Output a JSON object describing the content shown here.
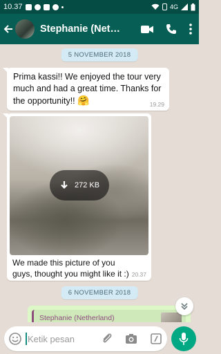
{
  "status_bar": {
    "time": "10.37",
    "network": "4G"
  },
  "header": {
    "contact_name": "Stephanie (Netherland)"
  },
  "messages": [
    {
      "type": "date",
      "text": "5 NOVEMBER 2018"
    },
    {
      "type": "text",
      "text": "Prima kassi!! We enjoyed the tour very much and had a great time. Thanks for the opportunity!!",
      "emoji": "🤗",
      "time": "19.29"
    },
    {
      "type": "image",
      "download_size": "272 KB",
      "caption": "We made this picture of you guys, thought you might like it :)",
      "time": "20.37"
    },
    {
      "type": "date",
      "text": "6 NOVEMBER 2018"
    },
    {
      "type": "reply",
      "quoted_name": "Stephanie (Netherland)"
    }
  ],
  "input": {
    "placeholder": "Ketik pesan"
  },
  "colors": {
    "header": "#075e54",
    "accent": "#00a884",
    "chat_bg": "#e5ddd5",
    "outgoing": "#dcf8c6",
    "quote_name": "#8e4e7d"
  }
}
